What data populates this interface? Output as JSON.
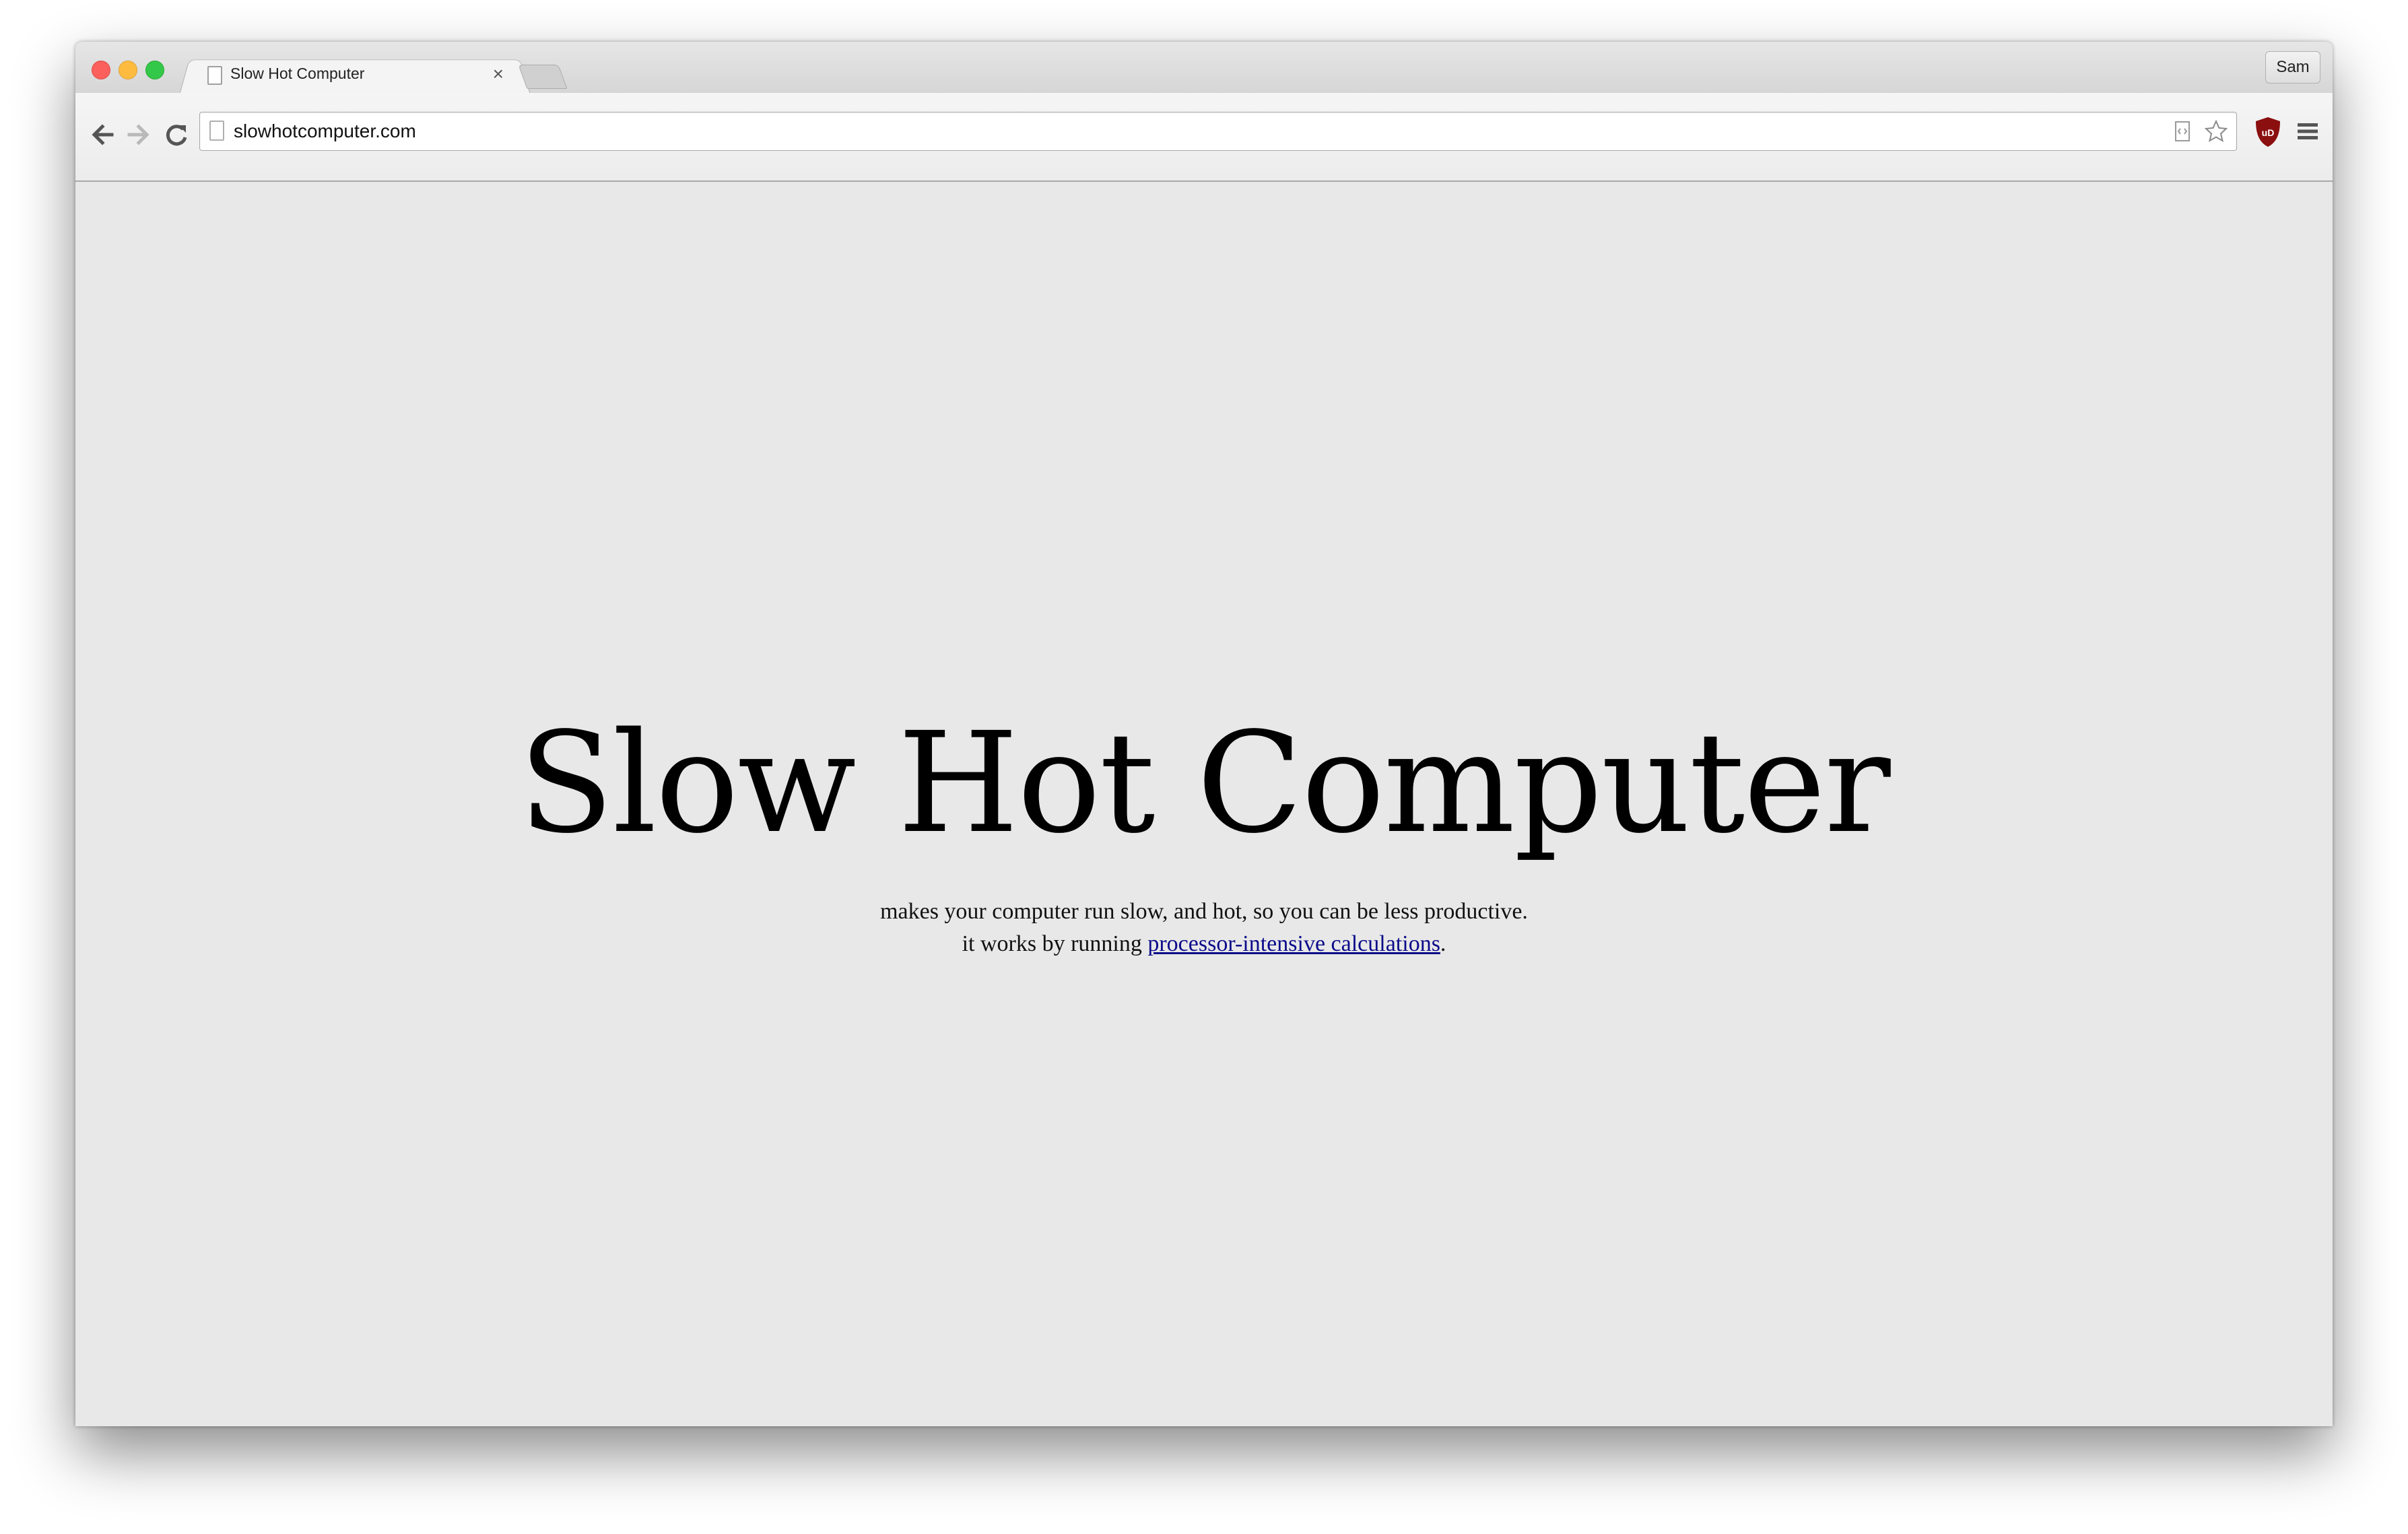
{
  "browser": {
    "tab_title": "Slow Hot Computer",
    "tab_close": "×",
    "profile_name": "Sam",
    "url": "slowhotcomputer.com",
    "extension_badge": "uD"
  },
  "icons": {
    "back": "back-arrow-icon",
    "forward": "forward-arrow-icon",
    "reload": "reload-icon",
    "page": "page-icon",
    "source": "view-source-icon",
    "bookmark": "star-icon",
    "extension": "ublock-shield-icon",
    "menu": "hamburger-menu-icon"
  },
  "colors": {
    "page_background": "#e8e8e8",
    "link": "#0b0b8a",
    "extension_shield": "#8b0f0f"
  },
  "page": {
    "title": "Slow Hot Computer",
    "line1": "makes your computer run slow, and hot, so you can be less productive.",
    "line2_prefix": "it works by running ",
    "line2_link": "processor-intensive calculations",
    "line2_suffix": "."
  }
}
